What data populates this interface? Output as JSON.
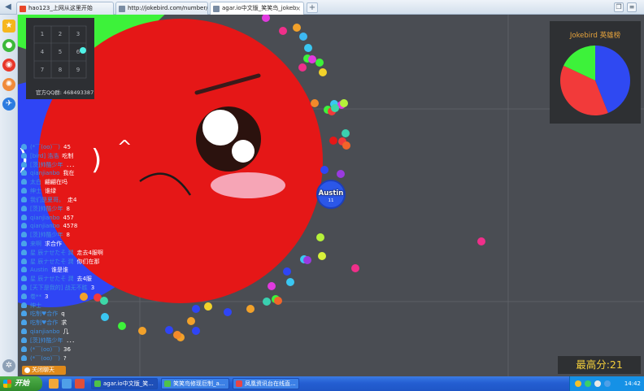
{
  "browser": {
    "tabs": [
      {
        "label": "hao123_上网从这里开始",
        "active": false,
        "icon_color": "#e8472a"
      },
      {
        "label": "http://jokebird.com/number/",
        "active": false,
        "icon_color": "#7a8ca3"
      },
      {
        "label": "agar.io中文版_笑笑鸟_jokeb:",
        "active": true,
        "icon_color": "#7a8ca3"
      }
    ],
    "new_tab_label": "+"
  },
  "sidebar": {
    "icons": [
      "star-icon",
      "chat-bubble-icon",
      "weibo-icon",
      "target-icon",
      "compass-icon"
    ],
    "settings_icon": "gear-icon"
  },
  "minimap": {
    "cells": [
      "1",
      "2",
      "3",
      "4",
      "5",
      "6",
      "7",
      "8",
      "9"
    ],
    "qq_group": "官方QQ群: 468493387"
  },
  "leaderboard": {
    "title": "Jokebird 英雄榜",
    "slices": [
      {
        "share": 0.44,
        "color": "#2f49f2"
      },
      {
        "share": 0.38,
        "color": "#f23a3a"
      },
      {
        "share": 0.18,
        "color": "#3df23a"
      }
    ]
  },
  "player": {
    "name": "Austin",
    "mass": "11"
  },
  "score": {
    "label": "最高分:21"
  },
  "chat": {
    "messages": [
      {
        "name": "(*￣(oo)￣)",
        "text": "45"
      },
      {
        "name": "[bird] 浩浩",
        "text": "吃制"
      },
      {
        "name": "[茨]帅酷少年",
        "text": "．．．"
      },
      {
        "name": "qianjianbo",
        "text": "我在"
      },
      {
        "name": "太白",
        "text": "翩翩在吗"
      },
      {
        "name": "绅士",
        "text": "谁绿"
      },
      {
        "name": "我们是夏哥。",
        "text": "走4"
      },
      {
        "name": "[茨]帅酷少年",
        "text": "8"
      },
      {
        "name": "qianjianbo",
        "text": "457"
      },
      {
        "name": "qianjianbo",
        "text": "4578"
      },
      {
        "name": "[茨]帅酷少年",
        "text": "8"
      },
      {
        "name": "来啊",
        "text": "求合作"
      },
      {
        "name": "星 辰ナせたそ 潤",
        "text": "走去4服啊"
      },
      {
        "name": "星 辰ナせたそ 潤",
        "text": "你们在那"
      },
      {
        "name": "Austin",
        "text": "谁是谁"
      },
      {
        "name": "星 辰ナせたそ 潤",
        "text": "去4服"
      },
      {
        "name": "[天下是我的] 战无不胜",
        "text": "3"
      },
      {
        "name": "卷**",
        "text": "3"
      },
      {
        "name": "绅士",
        "text": ""
      },
      {
        "name": "吃制♥合作",
        "text": "q"
      },
      {
        "name": "吃制♥合作",
        "text": "求"
      },
      {
        "name": "qianjianbo",
        "text": "几"
      },
      {
        "name": "[茨]帅酷少年",
        "text": "．．．"
      },
      {
        "name": "(*￣(oo)￣)",
        "text": "36"
      },
      {
        "name": "(*￣(oo)￣)",
        "text": "?"
      }
    ],
    "close_label": "关闭聊天"
  },
  "taskbar": {
    "start_label": "开始",
    "tasks": [
      {
        "label": "agar.io中文版_笑...",
        "active": true,
        "icon_color": "#4fc24a"
      },
      {
        "label": "笑笑鸟修现巨制_a...",
        "active": false,
        "icon_color": "#4fc24a"
      },
      {
        "label": "凤凰资讯台在线直...",
        "active": false,
        "icon_color": "#e84545"
      }
    ],
    "clock": "14:42"
  },
  "colors": {
    "background": "#4a4d53",
    "grid": "#5c6066",
    "big_red_cell": "#e51717",
    "blue_cell": "#2f45f5",
    "player_cell": "#2b57e8",
    "score_text": "#f4cf3b",
    "leaderboard_title": "#e6a33c",
    "chat_name": "#3d8de0"
  }
}
